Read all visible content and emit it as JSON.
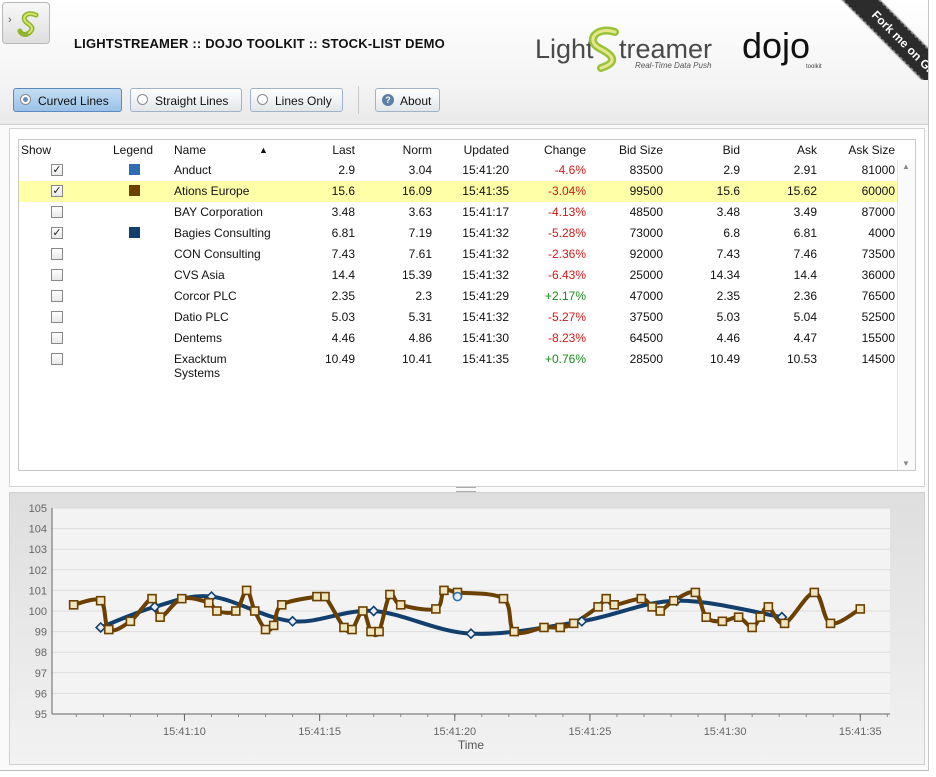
{
  "header": {
    "title": "LIGHTSTREAMER :: DOJO TOOLKIT :: STOCK-LIST DEMO",
    "toggle_icon": "dock-toggle-icon",
    "ls_logo_name": "Light",
    "ls_logo_name2": "treamer",
    "ls_logo_tagline": "Real-Time Data Push",
    "dojo_logo": "dojo",
    "dojo_logo_sub": "toolkit",
    "fork_ribbon": "Fork me on GitHub"
  },
  "toolbar": {
    "curved": "Curved Lines",
    "straight": "Straight Lines",
    "lines_only": "Lines Only",
    "about": "About",
    "active": "Curved Lines"
  },
  "grid": {
    "columns": [
      "Show",
      "Legend",
      "Name",
      "Last",
      "Norm",
      "Updated",
      "Change",
      "Bid Size",
      "Bid",
      "Ask",
      "Ask Size"
    ],
    "sort_indicator": "▲",
    "rows": [
      {
        "show": true,
        "legend": "#2f6fb1",
        "name": "Anduct",
        "name2": "",
        "last": "2.9",
        "norm": "3.04",
        "updated": "15:41:20",
        "change": "-4.6%",
        "bid_size": "83500",
        "bid": "2.9",
        "ask": "2.91",
        "ask_size": "81000",
        "selected": false
      },
      {
        "show": true,
        "legend": "#6b4000",
        "name": "Ations Europe",
        "name2": "",
        "last": "15.6",
        "norm": "16.09",
        "updated": "15:41:35",
        "change": "-3.04%",
        "bid_size": "99500",
        "bid": "15.6",
        "ask": "15.62",
        "ask_size": "60000",
        "selected": true
      },
      {
        "show": false,
        "legend": "",
        "name": "BAY Corporation",
        "name2": "",
        "last": "3.48",
        "norm": "3.63",
        "updated": "15:41:17",
        "change": "-4.13%",
        "bid_size": "48500",
        "bid": "3.48",
        "ask": "3.49",
        "ask_size": "87000",
        "selected": false
      },
      {
        "show": true,
        "legend": "#123f6d",
        "name": "Bagies Consulting",
        "name2": "",
        "last": "6.81",
        "norm": "7.19",
        "updated": "15:41:32",
        "change": "-5.28%",
        "bid_size": "73000",
        "bid": "6.8",
        "ask": "6.81",
        "ask_size": "4000",
        "selected": false
      },
      {
        "show": false,
        "legend": "",
        "name": "CON Consulting",
        "name2": "",
        "last": "7.43",
        "norm": "7.61",
        "updated": "15:41:32",
        "change": "-2.36%",
        "bid_size": "92000",
        "bid": "7.43",
        "ask": "7.46",
        "ask_size": "73500",
        "selected": false
      },
      {
        "show": false,
        "legend": "",
        "name": "CVS Asia",
        "name2": "",
        "last": "14.4",
        "norm": "15.39",
        "updated": "15:41:32",
        "change": "-6.43%",
        "bid_size": "25000",
        "bid": "14.34",
        "ask": "14.4",
        "ask_size": "36000",
        "selected": false
      },
      {
        "show": false,
        "legend": "",
        "name": "Corcor PLC",
        "name2": "",
        "last": "2.35",
        "norm": "2.3",
        "updated": "15:41:29",
        "change": "+2.17%",
        "bid_size": "47000",
        "bid": "2.35",
        "ask": "2.36",
        "ask_size": "76500",
        "selected": false
      },
      {
        "show": false,
        "legend": "",
        "name": "Datio PLC",
        "name2": "",
        "last": "5.03",
        "norm": "5.31",
        "updated": "15:41:32",
        "change": "-5.27%",
        "bid_size": "37500",
        "bid": "5.03",
        "ask": "5.04",
        "ask_size": "52500",
        "selected": false
      },
      {
        "show": false,
        "legend": "",
        "name": "Dentems",
        "name2": "",
        "last": "4.46",
        "norm": "4.86",
        "updated": "15:41:30",
        "change": "-8.23%",
        "bid_size": "64500",
        "bid": "4.46",
        "ask": "4.47",
        "ask_size": "15500",
        "selected": false
      },
      {
        "show": false,
        "legend": "",
        "name": "Exacktum",
        "name2": "Systems",
        "last": "10.49",
        "norm": "10.41",
        "updated": "15:41:35",
        "change": "+0.76%",
        "bid_size": "28500",
        "bid": "10.49",
        "ask": "10.53",
        "ask_size": "14500",
        "selected": false
      }
    ]
  },
  "colors": {
    "ations": "#6b4000",
    "bagies": "#123f6d",
    "anduct": "#2f6fb1",
    "negative": "#d01818",
    "positive": "#1a8a1a",
    "selected_row": "#ffffa8"
  },
  "chart_data": {
    "type": "line",
    "xlabel": "Time",
    "ylabel": "",
    "ylim": [
      95,
      105
    ],
    "yticks": [
      "95",
      "96",
      "97",
      "98",
      "99",
      "100",
      "101",
      "102",
      "103",
      "104",
      "105"
    ],
    "xticks": [
      {
        "label": "15:41:10",
        "t": 10
      },
      {
        "label": "15:41:15",
        "t": 15
      },
      {
        "label": "15:41:20",
        "t": 20
      },
      {
        "label": "15:41:25",
        "t": 25
      },
      {
        "label": "15:41:30",
        "t": 30
      },
      {
        "label": "15:41:35",
        "t": 35
      }
    ],
    "grid": true,
    "series": [
      {
        "color": "#6b4000",
        "marker": "square",
        "points": [
          [
            5.9,
            100.3
          ],
          [
            6.9,
            100.5
          ],
          [
            7.2,
            99.1
          ],
          [
            8.0,
            99.5
          ],
          [
            8.8,
            100.6
          ],
          [
            9.1,
            99.7
          ],
          [
            9.9,
            100.6
          ],
          [
            10.9,
            100.4
          ],
          [
            11.2,
            100.0
          ],
          [
            11.9,
            100.0
          ],
          [
            12.3,
            101.0
          ],
          [
            12.6,
            100.0
          ],
          [
            13.0,
            99.1
          ],
          [
            13.3,
            99.3
          ],
          [
            13.6,
            100.3
          ],
          [
            14.9,
            100.7
          ],
          [
            15.2,
            100.7
          ],
          [
            15.9,
            99.2
          ],
          [
            16.2,
            99.1
          ],
          [
            16.6,
            100.0
          ],
          [
            16.9,
            99.0
          ],
          [
            17.2,
            99.0
          ],
          [
            17.6,
            100.8
          ],
          [
            18.0,
            100.3
          ],
          [
            19.3,
            100.1
          ],
          [
            19.6,
            101.0
          ],
          [
            20.1,
            100.9
          ],
          [
            21.8,
            100.6
          ],
          [
            22.2,
            99.0
          ],
          [
            23.3,
            99.2
          ],
          [
            23.9,
            99.2
          ],
          [
            24.4,
            99.4
          ],
          [
            25.3,
            100.2
          ],
          [
            25.6,
            100.6
          ],
          [
            25.9,
            100.3
          ],
          [
            26.9,
            100.6
          ],
          [
            27.3,
            100.2
          ],
          [
            27.6,
            100.0
          ],
          [
            28.1,
            100.5
          ],
          [
            28.9,
            100.9
          ],
          [
            29.3,
            99.7
          ],
          [
            29.9,
            99.5
          ],
          [
            30.5,
            99.7
          ],
          [
            31.0,
            99.2
          ],
          [
            31.3,
            99.7
          ],
          [
            31.6,
            100.2
          ],
          [
            32.2,
            99.4
          ],
          [
            33.3,
            100.9
          ],
          [
            33.9,
            99.4
          ],
          [
            35.0,
            100.1
          ]
        ]
      },
      {
        "color": "#123f6d",
        "marker": "diamond",
        "points": [
          [
            6.9,
            99.2
          ],
          [
            8.9,
            100.2
          ],
          [
            11.0,
            100.7
          ],
          [
            14.0,
            99.5
          ],
          [
            17.0,
            100.0
          ],
          [
            20.6,
            98.9
          ],
          [
            24.7,
            99.5
          ],
          [
            28.2,
            100.5
          ],
          [
            32.1,
            99.7
          ]
        ]
      },
      {
        "color": "#2f6fb1",
        "marker": "circle",
        "points": [
          [
            20.1,
            100.7
          ]
        ]
      }
    ]
  }
}
